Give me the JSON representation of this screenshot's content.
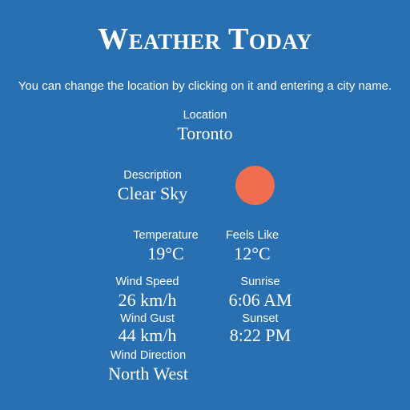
{
  "header": {
    "title": "Weather Today",
    "instructions": "You can change the location by clicking on it and entering a city name."
  },
  "location": {
    "label": "Location",
    "value": "Toronto"
  },
  "description": {
    "label": "Description",
    "value": "Clear Sky",
    "icon": "sun-icon",
    "icon_color": "#ef6e4f"
  },
  "temperature": {
    "label": "Temperature",
    "value": "19°C"
  },
  "feels_like": {
    "label": "Feels Like",
    "value": "12°C"
  },
  "wind_speed": {
    "label": "Wind Speed",
    "value": "26 km/h"
  },
  "sunrise": {
    "label": "Sunrise",
    "value": "6:06 AM"
  },
  "wind_gust": {
    "label": "Wind Gust",
    "value": "44 km/h"
  },
  "sunset": {
    "label": "Sunset",
    "value": "8:22 PM"
  },
  "wind_direction": {
    "label": "Wind Direction",
    "value": "North West"
  },
  "colors": {
    "background": "#2870b1",
    "text": "#ffffff",
    "sun": "#ef6e4f"
  }
}
